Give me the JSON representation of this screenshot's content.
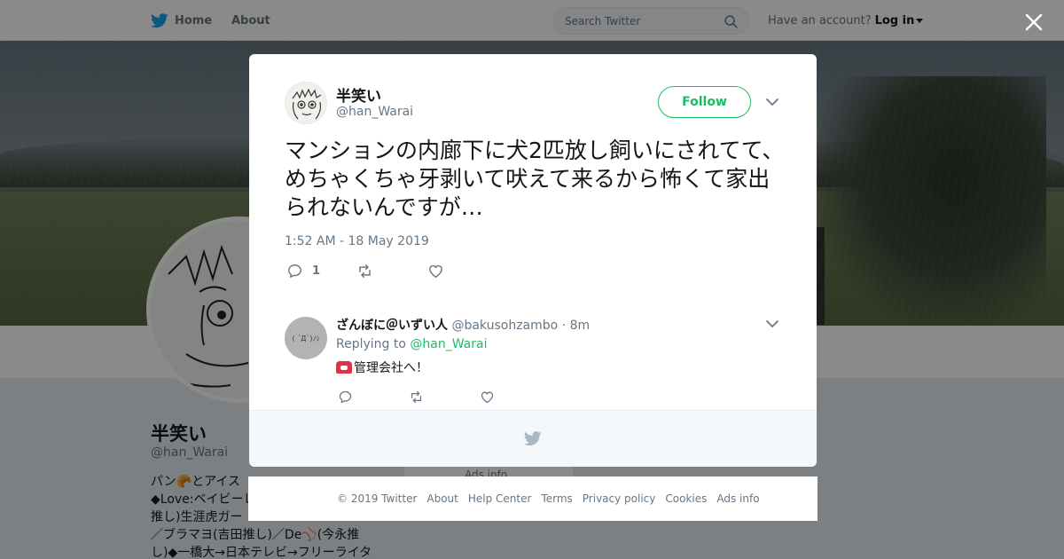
{
  "nav": {
    "home": "Home",
    "about": "About",
    "search_placeholder": "Search Twitter",
    "have_account": "Have an account?",
    "login": "Log in"
  },
  "profile": {
    "name": "半笑い",
    "handle": "@han_Warai",
    "bio_lines": [
      "パン🥐とアイス",
      "◆Love:ベイビーレ",
      "推し)生涯虎ガー",
      "／ブラマヨ(吉田推し)／De⚾(今永推",
      "し)◆一橋大→日本テレビ→フリーライタ"
    ],
    "ads_info": "Ads info"
  },
  "tweet": {
    "name": "半笑い",
    "handle": "@han_Warai",
    "follow_label": "Follow",
    "text": "マンションの内廊下に犬2匹放し飼いにされてて、めちゃくちゃ牙剥いて吠えて来るから怖くて家出られないんですが…",
    "timestamp": "1:52 AM - 18 May 2019",
    "reply_count": "1"
  },
  "reply": {
    "name": "ざんぼに＠いずい人",
    "handle": "@bakusohzambo",
    "time": "· 8m",
    "replying_to_label": "Replying to",
    "replying_to_handle": "@han_Warai",
    "text": "管理会社へ！",
    "avatar_text": "( ´Д`)ﾉｼ"
  },
  "footer": {
    "copyright": "© 2019 Twitter",
    "about": "About",
    "help": "Help Center",
    "terms": "Terms",
    "privacy": "Privacy policy",
    "cookies": "Cookies",
    "ads": "Ads info"
  },
  "colors": {
    "twitter_blue": "#1da1f2",
    "follow_green": "#17bf63",
    "muted_text": "#657786"
  },
  "icons": [
    "twitter-bird-icon",
    "search-icon",
    "close-icon",
    "chevron-down-icon",
    "reply-icon",
    "retweet-icon",
    "like-icon",
    "telephone-icon"
  ]
}
